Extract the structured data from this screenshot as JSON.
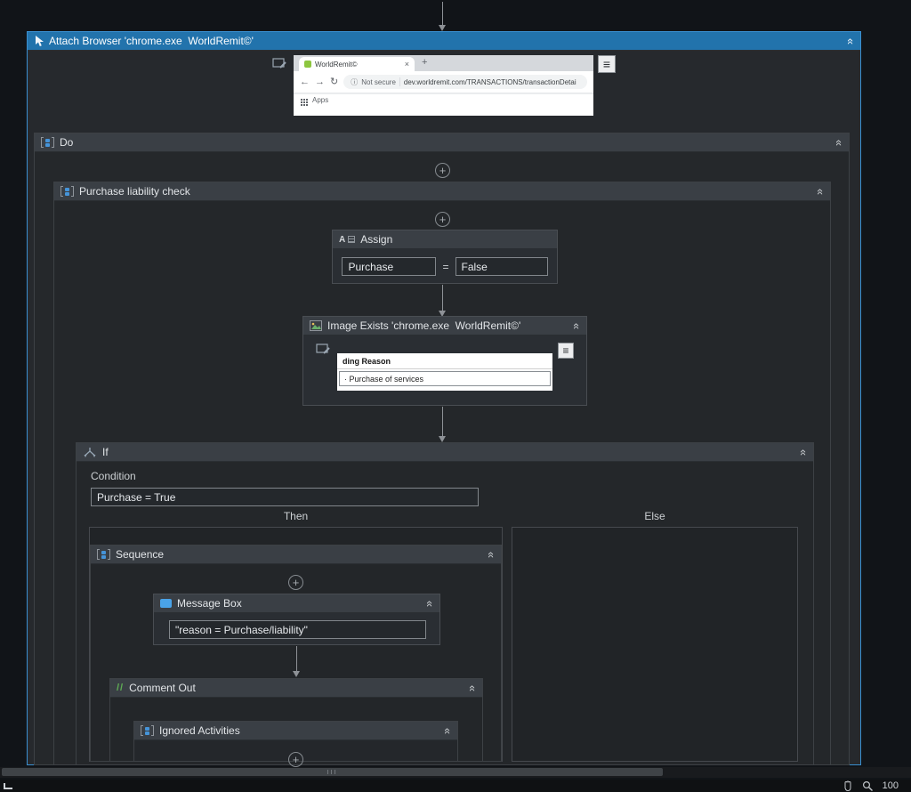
{
  "attach_browser": {
    "title": "Attach Browser 'chrome.exe  WorldRemit©'"
  },
  "browser_preview": {
    "tab_title": "WorldRemit©",
    "close_tab": "×",
    "new_tab": "+",
    "back": "←",
    "forward": "→",
    "refresh": "↻",
    "info": "ⓘ",
    "security": "Not secure",
    "url": "dev.worldremit.com/TRANSACTIONS/transactionDetai",
    "bookmarks_label": "Apps"
  },
  "do_sequence": {
    "title": "Do"
  },
  "purchase_check": {
    "title": "Purchase liability check"
  },
  "assign": {
    "title": "Assign",
    "to_value": "Purchase",
    "equals": "=",
    "value": "False"
  },
  "image_exists": {
    "title": "Image Exists 'chrome.exe  WorldRemit©'",
    "preview_heading": "ding Reason",
    "preview_option": "· Purchase of services"
  },
  "if_activity": {
    "title": "If",
    "condition_label": "Condition",
    "condition_value": "Purchase = True",
    "then_label": "Then",
    "else_label": "Else"
  },
  "then_sequence": {
    "title": "Sequence"
  },
  "message_box": {
    "title": "Message Box",
    "text": "\"reason = Purchase/liability\""
  },
  "comment_out": {
    "title": "Comment Out",
    "slashes": "//"
  },
  "ignored_activities": {
    "title": "Ignored Activities"
  },
  "status_bar": {
    "zoom_level": "100"
  },
  "icons": {
    "add": "+",
    "collapse": "«",
    "burger": "≡",
    "assign_letter": "A"
  }
}
